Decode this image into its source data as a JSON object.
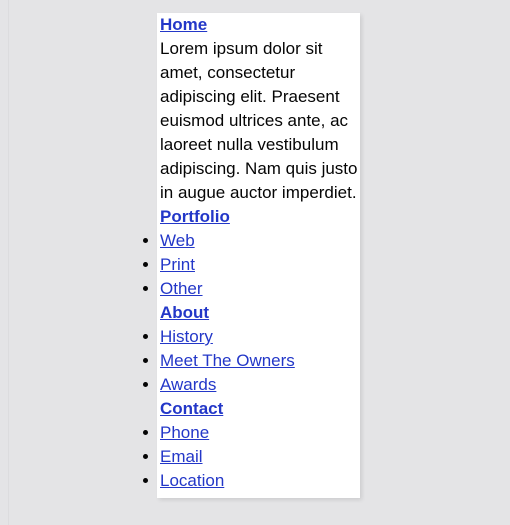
{
  "page": {
    "background_color": "#e4e4e6",
    "card_background_color": "#ffffff",
    "link_color": "#2337c8",
    "text_color": "#050505"
  },
  "content": {
    "sections": [
      {
        "heading": "Home",
        "paragraph": "Lorem ipsum dolor sit amet, consectetur adipiscing elit. Praesent euismod ultrices ante, ac laoreet nulla vestibulum adipiscing. Nam quis justo in augue auctor imperdiet.",
        "items": []
      },
      {
        "heading": "Portfolio",
        "paragraph": "",
        "items": [
          "Web",
          "Print",
          "Other"
        ]
      },
      {
        "heading": "About",
        "paragraph": "",
        "items": [
          "History",
          "Meet The Owners",
          "Awards"
        ]
      },
      {
        "heading": "Contact",
        "paragraph": "",
        "items": [
          "Phone",
          "Email",
          "Location"
        ]
      }
    ]
  }
}
